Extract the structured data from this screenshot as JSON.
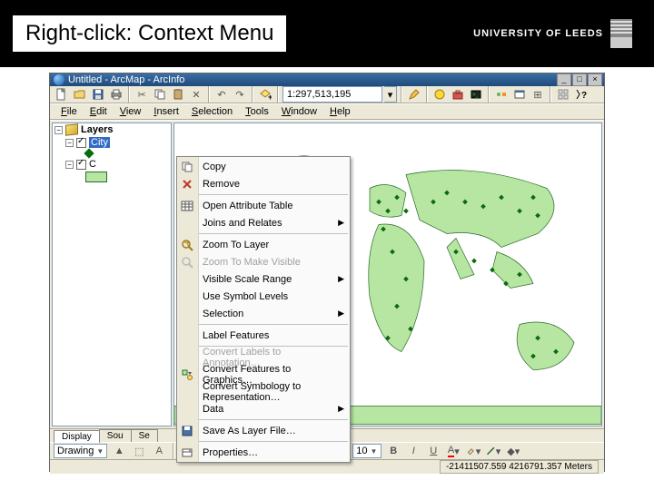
{
  "slide": {
    "title": "Right-click: Context Menu",
    "uni": "UNIVERSITY OF LEEDS"
  },
  "window": {
    "title": "Untitled - ArcMap - ArcInfo",
    "scale": "1:297,513,195",
    "menu": [
      "File",
      "Edit",
      "View",
      "Insert",
      "Selection",
      "Tools",
      "Window",
      "Help"
    ],
    "menu_access": [
      "F",
      "E",
      "V",
      "I",
      "S",
      "T",
      "W",
      "H"
    ]
  },
  "toc": {
    "root": "Layers",
    "layer1": "City",
    "layer2": "C",
    "tabs": [
      "Display",
      "Sou",
      "Se"
    ]
  },
  "context_menu": {
    "items": [
      {
        "label": "Copy",
        "icon": "copy",
        "enabled": true
      },
      {
        "label": "Remove",
        "icon": "remove",
        "enabled": true
      },
      {
        "sep": true
      },
      {
        "label": "Open Attribute Table",
        "icon": "table",
        "enabled": true
      },
      {
        "label": "Joins and Relates",
        "submenu": true,
        "enabled": true
      },
      {
        "sep": true
      },
      {
        "label": "Zoom To Layer",
        "icon": "zoom",
        "enabled": true
      },
      {
        "label": "Zoom To Make Visible",
        "icon": "zoom2",
        "enabled": false
      },
      {
        "label": "Visible Scale Range",
        "submenu": true,
        "enabled": true
      },
      {
        "label": "Use Symbol Levels",
        "enabled": true
      },
      {
        "label": "Selection",
        "submenu": true,
        "enabled": true
      },
      {
        "sep": true
      },
      {
        "label": "Label Features",
        "enabled": true
      },
      {
        "sep": true
      },
      {
        "label": "Convert Labels to Annotation…",
        "enabled": false
      },
      {
        "label": "Convert Features to Graphics…",
        "icon": "convert",
        "enabled": true
      },
      {
        "label": "Convert Symbology to Representation…",
        "enabled": true
      },
      {
        "label": "Data",
        "submenu": true,
        "enabled": true
      },
      {
        "sep": true
      },
      {
        "label": "Save As Layer File…",
        "icon": "save",
        "enabled": true
      },
      {
        "sep": true
      },
      {
        "label": "Properties…",
        "icon": "props",
        "enabled": true
      }
    ]
  },
  "drawing": {
    "label": "Drawing",
    "font": "",
    "size": "10",
    "buttons": {
      "bold": "B",
      "italic": "I",
      "underline": "U",
      "fontcolor": "A"
    }
  },
  "status": {
    "coords": "-21411507.559 4216791.357 Meters"
  },
  "icons": {
    "new": "new-icon",
    "open": "open-icon",
    "save": "save-icon",
    "print": "print-icon",
    "cut": "cut-icon",
    "copy": "copy-icon",
    "paste": "paste-icon",
    "remove": "remove-icon",
    "undo": "undo-icon",
    "redo": "redo-icon",
    "add": "add-icon",
    "editor": "editor-icon",
    "catalog": "catalog-icon",
    "toolbox": "toolbox-icon",
    "cmd": "cmd-icon",
    "help": "help-icon"
  }
}
